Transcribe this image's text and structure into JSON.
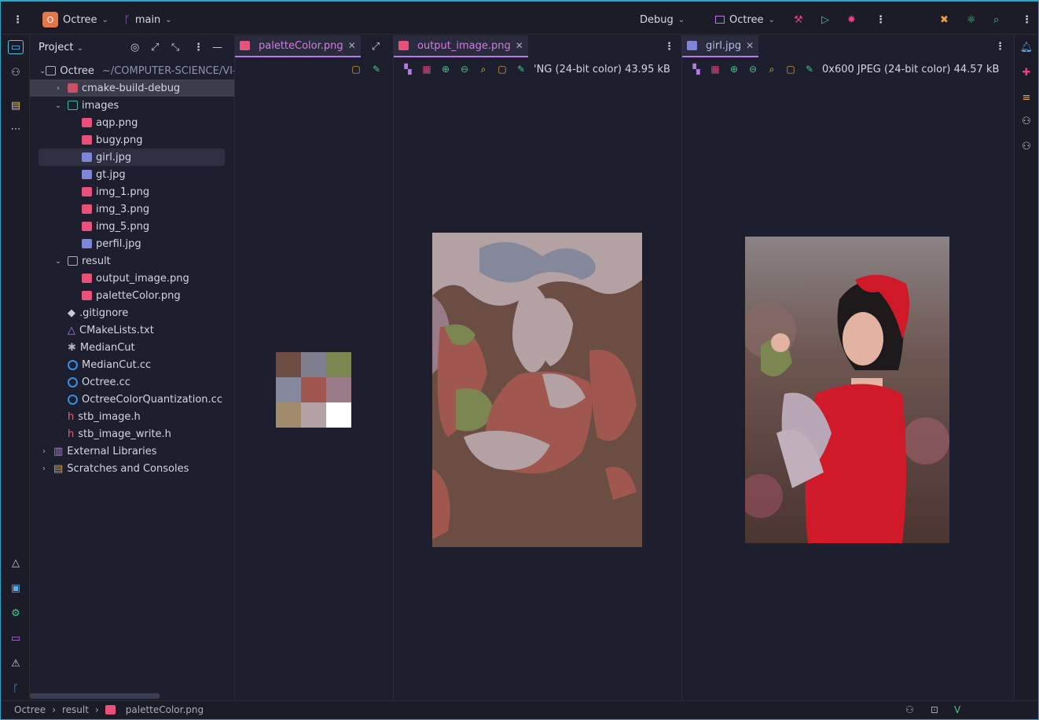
{
  "titlebar": {
    "project_badge": "O",
    "project_name": "Octree",
    "branch": "main",
    "run_config": "Debug",
    "target": "Octree"
  },
  "project_panel": {
    "title": "Project",
    "tree": [
      {
        "label": "Octree",
        "path": "~/COMPUTER-SCIENCE/VI-CICLO/EDA/Octree",
        "indent": 0,
        "arrow": "open",
        "icon": "folder"
      },
      {
        "label": "cmake-build-debug",
        "indent": 1,
        "arrow": "closed",
        "icon": "folder-red"
      },
      {
        "label": "images",
        "indent": 1,
        "arrow": "open",
        "icon": "folder-teal"
      },
      {
        "label": "aqp.png",
        "indent": 2,
        "icon": "png"
      },
      {
        "label": "bugy.png",
        "indent": 2,
        "icon": "png"
      },
      {
        "label": "girl.jpg",
        "indent": 2,
        "icon": "jpg",
        "selected": true
      },
      {
        "label": "gt.jpg",
        "indent": 2,
        "icon": "jpg"
      },
      {
        "label": "img_1.png",
        "indent": 2,
        "icon": "png"
      },
      {
        "label": "img_3.png",
        "indent": 2,
        "icon": "png"
      },
      {
        "label": "img_5.png",
        "indent": 2,
        "icon": "png"
      },
      {
        "label": "perfil.jpg",
        "indent": 2,
        "icon": "jpg"
      },
      {
        "label": "result",
        "indent": 1,
        "arrow": "open",
        "icon": "folder"
      },
      {
        "label": "output_image.png",
        "indent": 2,
        "icon": "png"
      },
      {
        "label": "paletteColor.png",
        "indent": 2,
        "icon": "png"
      },
      {
        "label": ".gitignore",
        "indent": 1,
        "icon": "git"
      },
      {
        "label": "CMakeLists.txt",
        "indent": 1,
        "icon": "cmake"
      },
      {
        "label": "MedianCut",
        "indent": 1,
        "icon": "exec"
      },
      {
        "label": "MedianCut.cc",
        "indent": 1,
        "icon": "cc"
      },
      {
        "label": "Octree.cc",
        "indent": 1,
        "icon": "cc"
      },
      {
        "label": "OctreeColorQuantization.cc",
        "indent": 1,
        "icon": "cc"
      },
      {
        "label": "stb_image.h",
        "indent": 1,
        "icon": "h"
      },
      {
        "label": "stb_image_write.h",
        "indent": 1,
        "icon": "h"
      },
      {
        "label": "External Libraries",
        "indent": 0,
        "arrow": "closed",
        "icon": "lib"
      },
      {
        "label": "Scratches and Consoles",
        "indent": 0,
        "arrow": "closed",
        "icon": "scratch"
      }
    ]
  },
  "panes": {
    "palette": {
      "tab": "paletteColor.png",
      "colors": [
        "#6b4d44",
        "#7e7f8d",
        "#7b8650",
        "#85889a",
        "#9f574f",
        "#9a7b88",
        "#a08c6c",
        "#b3a1a4",
        "#ffffff"
      ]
    },
    "output": {
      "tab": "output_image.png",
      "info": "'NG (24-bit color) 43.95 kB"
    },
    "girl": {
      "tab": "girl.jpg",
      "info": "0x600 JPEG (24-bit color) 44.57 kB"
    }
  },
  "statusbar": {
    "crumbs": [
      "Octree",
      "result",
      "paletteColor.png"
    ]
  }
}
